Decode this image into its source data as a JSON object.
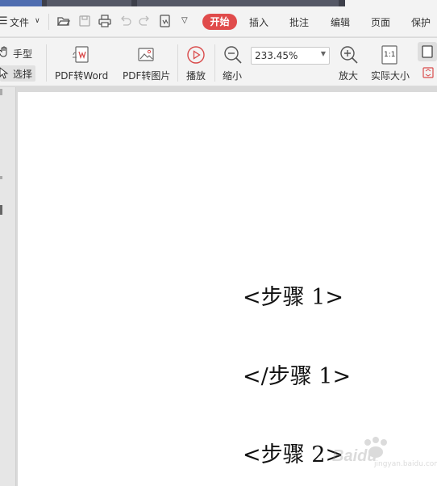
{
  "colors": {
    "accent": "#e04b4b",
    "toolbar_bg": "#f3f3f3",
    "workspace_bg": "#d9d9d9",
    "page_bg": "#ffffff"
  },
  "menu": {
    "file_icon": "hamburger-icon",
    "file_label": "文件",
    "quick_icons": [
      "folder-open-icon",
      "save-icon",
      "print-icon",
      "undo-icon",
      "redo-icon",
      "export-icon",
      "dropdown-icon"
    ],
    "tabs": [
      {
        "label": "开始",
        "active": true
      },
      {
        "label": "插入"
      },
      {
        "label": "批注"
      },
      {
        "label": "编辑"
      },
      {
        "label": "页面"
      },
      {
        "label": "保护"
      }
    ]
  },
  "toolbar": {
    "hand_label": "手型",
    "select_label": "选择",
    "pdf_to_word": "PDF转Word",
    "pdf_to_image": "PDF转图片",
    "play": "播放",
    "zoom_out": "缩小",
    "zoom_value": "233.45%",
    "zoom_in": "放大",
    "actual_size": "实际大小",
    "actual_size_icon_text": "1:1"
  },
  "document": {
    "lines": [
      "<步骤 1>",
      "</步骤 1>",
      "<步骤 2>"
    ]
  },
  "watermark": {
    "text": "Baidu",
    "sub": "jingyan.baidu.com"
  }
}
